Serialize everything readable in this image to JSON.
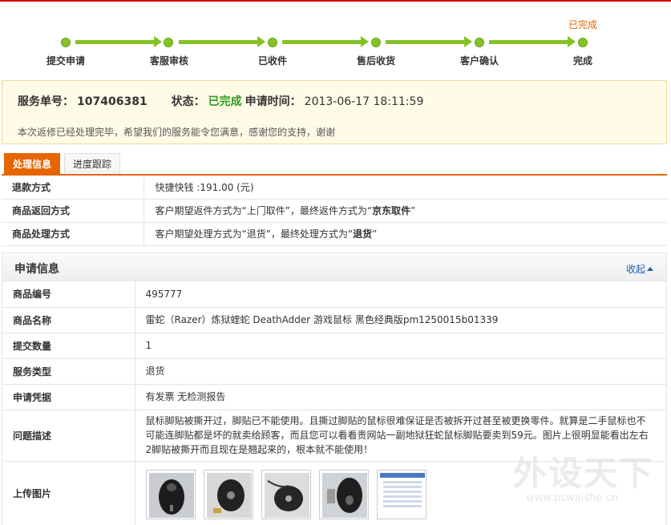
{
  "progress": {
    "done_tag": "已完成",
    "steps": [
      "提交申请",
      "客服审核",
      "已收件",
      "售后收货",
      "客户确认",
      "完成"
    ]
  },
  "summary": {
    "order_label": "服务单号：",
    "order_no": "107406381",
    "status_label": "状态：",
    "status_value": "已完成",
    "time_label": "申请时间：",
    "time_value": "2013-06-17 18:11:59",
    "note": "本次返修已经处理完毕，希望我们的服务能令您满意，感谢您的支持，谢谢"
  },
  "tabs": [
    "处理信息",
    "进度跟踪"
  ],
  "process_info": {
    "refund_label": "退款方式",
    "refund_value": "快捷快钱 :191.00 (元)",
    "return_label": "商品返回方式",
    "return_prefix": "客户期望返件方式为“上门取件”，最终返件方式为“",
    "return_final": "京东取件",
    "return_suffix": "”",
    "handle_label": "商品处理方式",
    "handle_prefix": "客户期望处理方式为“退货”，最终处理方式为“",
    "handle_final": "退货",
    "handle_suffix": "”"
  },
  "apply": {
    "title": "申请信息",
    "collapse": "收起",
    "rows": {
      "sku_label": "商品编号",
      "sku_value": "495777",
      "name_label": "商品名称",
      "name_value": "雷蛇（Razer）炼狱蝰蛇 DeathAdder 游戏鼠标 黑色经典版pm1250015b01339",
      "qty_label": "提交数量",
      "qty_value": "1",
      "type_label": "服务类型",
      "type_value": "退货",
      "proof_label": "申请凭据",
      "proof_value": "有发票 无检测报告",
      "desc_label": "问题描述",
      "desc_value": "鼠标脚贴被撕开过，脚贴已不能使用。且撕过脚贴的鼠标很难保证是否被拆开过甚至被更换零件。就算是二手鼠标也不可能连脚贴都是坏的就卖给顾客，而且您可以看看贵网站一副地狱狂蛇鼠标脚贴要卖到59元。图片上很明显能看出左右2脚贴被撕开而且现在是翘起来的，根本就不能使用！",
      "pic_label": "上传图片"
    }
  },
  "watermark": {
    "brand": "外设天下",
    "url": "www.pcwaishe.cn"
  },
  "colors": {
    "accent": "#e56600",
    "progress_green": "#84c226",
    "status_green": "#2e9b1c",
    "link_blue": "#1f5fa8"
  }
}
